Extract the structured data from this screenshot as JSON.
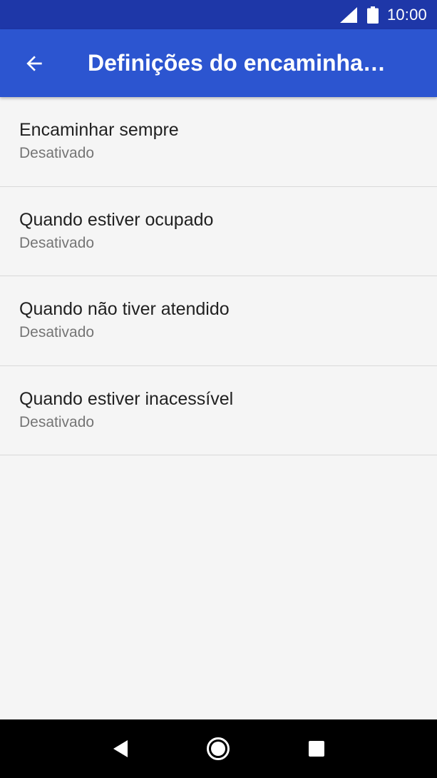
{
  "status_bar": {
    "time": "10:00",
    "icons": [
      "signal-icon",
      "battery-icon"
    ]
  },
  "app_bar": {
    "title": "Definições do encaminhamento de chamadas",
    "back_icon": "arrow-back-icon"
  },
  "settings": [
    {
      "title": "Encaminhar sempre",
      "summary": "Desativado"
    },
    {
      "title": "Quando estiver ocupado",
      "summary": "Desativado"
    },
    {
      "title": "Quando não tiver atendido",
      "summary": "Desativado"
    },
    {
      "title": "Quando estiver inacessível",
      "summary": "Desativado"
    }
  ],
  "nav_bar": {
    "icons": [
      "back-triangle-icon",
      "home-circle-icon",
      "recents-square-icon"
    ]
  },
  "colors": {
    "status_bar": "#1e37a8",
    "app_bar": "#2c55d0",
    "background": "#f5f5f5"
  }
}
